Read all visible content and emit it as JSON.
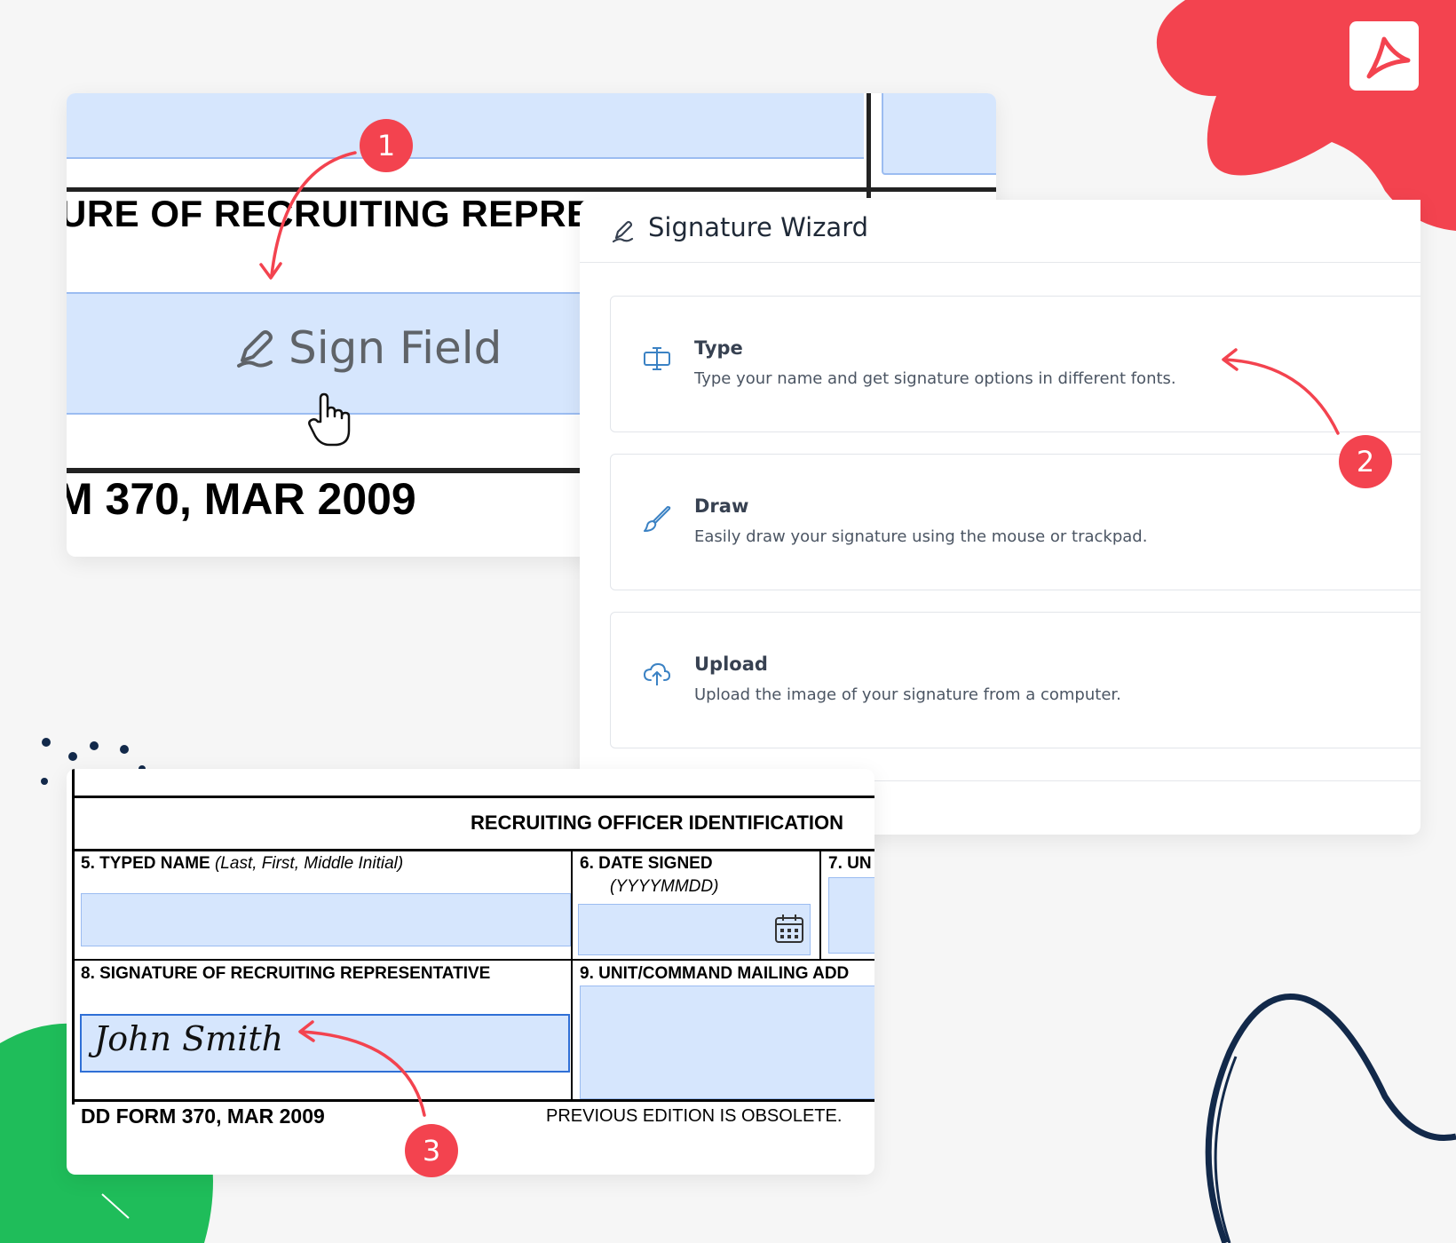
{
  "form_zoom": {
    "section_title": "URE OF RECRUITING REPRESENTATIVE",
    "sign_field_label": "Sign Field",
    "form_footer": "M 370, MAR 2009"
  },
  "wizard": {
    "title": "Signature Wizard",
    "options": [
      {
        "title": "Type",
        "description": "Type your name and get signature options in different fonts.",
        "icon": "text-cursor-icon"
      },
      {
        "title": "Draw",
        "description": "Easily draw your signature using the mouse or trackpad.",
        "icon": "brush-icon"
      },
      {
        "title": "Upload",
        "description": "Upload the image of your signature from a computer.",
        "icon": "cloud-upload-icon"
      }
    ]
  },
  "officer_form": {
    "section_header": "RECRUITING OFFICER IDENTIFICATION",
    "field5_label": "5.  TYPED NAME",
    "field5_hint": "(Last, First, Middle Initial)",
    "field6_label": "6. DATE SIGNED",
    "field6_hint": "(YYYYMMDD)",
    "field7_label": "7.  UN",
    "field8_label": "8.  SIGNATURE OF RECRUITING REPRESENTATIVE",
    "field9_label": "9. UNIT/COMMAND MAILING ADD",
    "signature_value": "John Smith",
    "footer_form": "DD FORM 370, MAR 2009",
    "footer_note": "PREVIOUS EDITION IS OBSOLETE."
  },
  "steps": [
    "1",
    "2",
    "3"
  ],
  "colors": {
    "accent_red": "#f3434f",
    "field_blue": "#d6e6fd",
    "field_border": "#9bbcf1",
    "decor_green": "#1fbd5a",
    "decor_navy": "#12294a"
  }
}
